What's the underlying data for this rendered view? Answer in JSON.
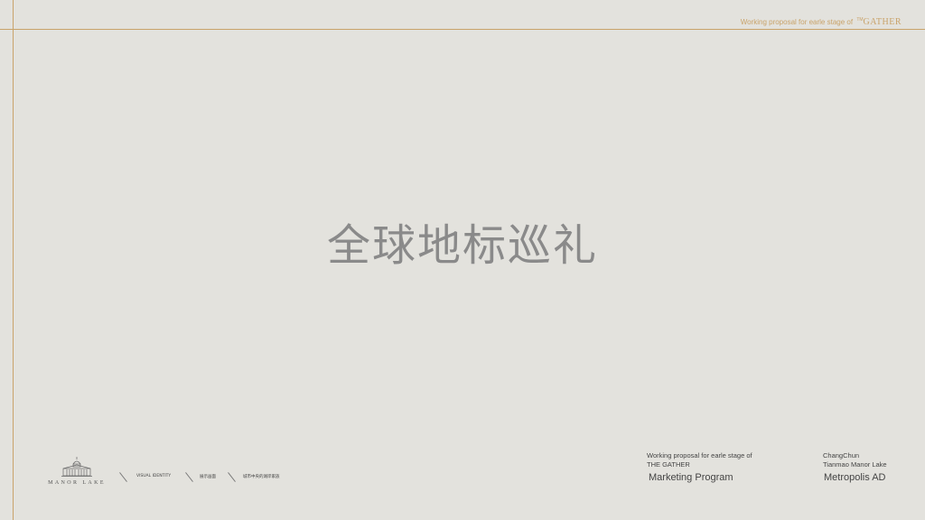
{
  "header": {
    "text": "Working proposal for earle stage of",
    "tm": "TM",
    "brand": "GATHER"
  },
  "title": "全球地标巡礼",
  "logo": {
    "text": "MANOR LAKE"
  },
  "footer_nav": [
    "VISUAL IDENTITY",
    "展示画面",
    "城市中央的湖岸家族"
  ],
  "proposal": {
    "line1": "Working proposal for earle stage of",
    "line2": "THE GATHER",
    "line3": "Marketing Program"
  },
  "project": {
    "line1": "ChangChun",
    "line2": "Tianmao Manor Lake",
    "line3": "Metropolis AD"
  },
  "colors": {
    "accent": "#c9a36a",
    "background": "#e3e2dd",
    "text": "#555555"
  },
  "icons": [
    "manor-house-logo-icon"
  ]
}
